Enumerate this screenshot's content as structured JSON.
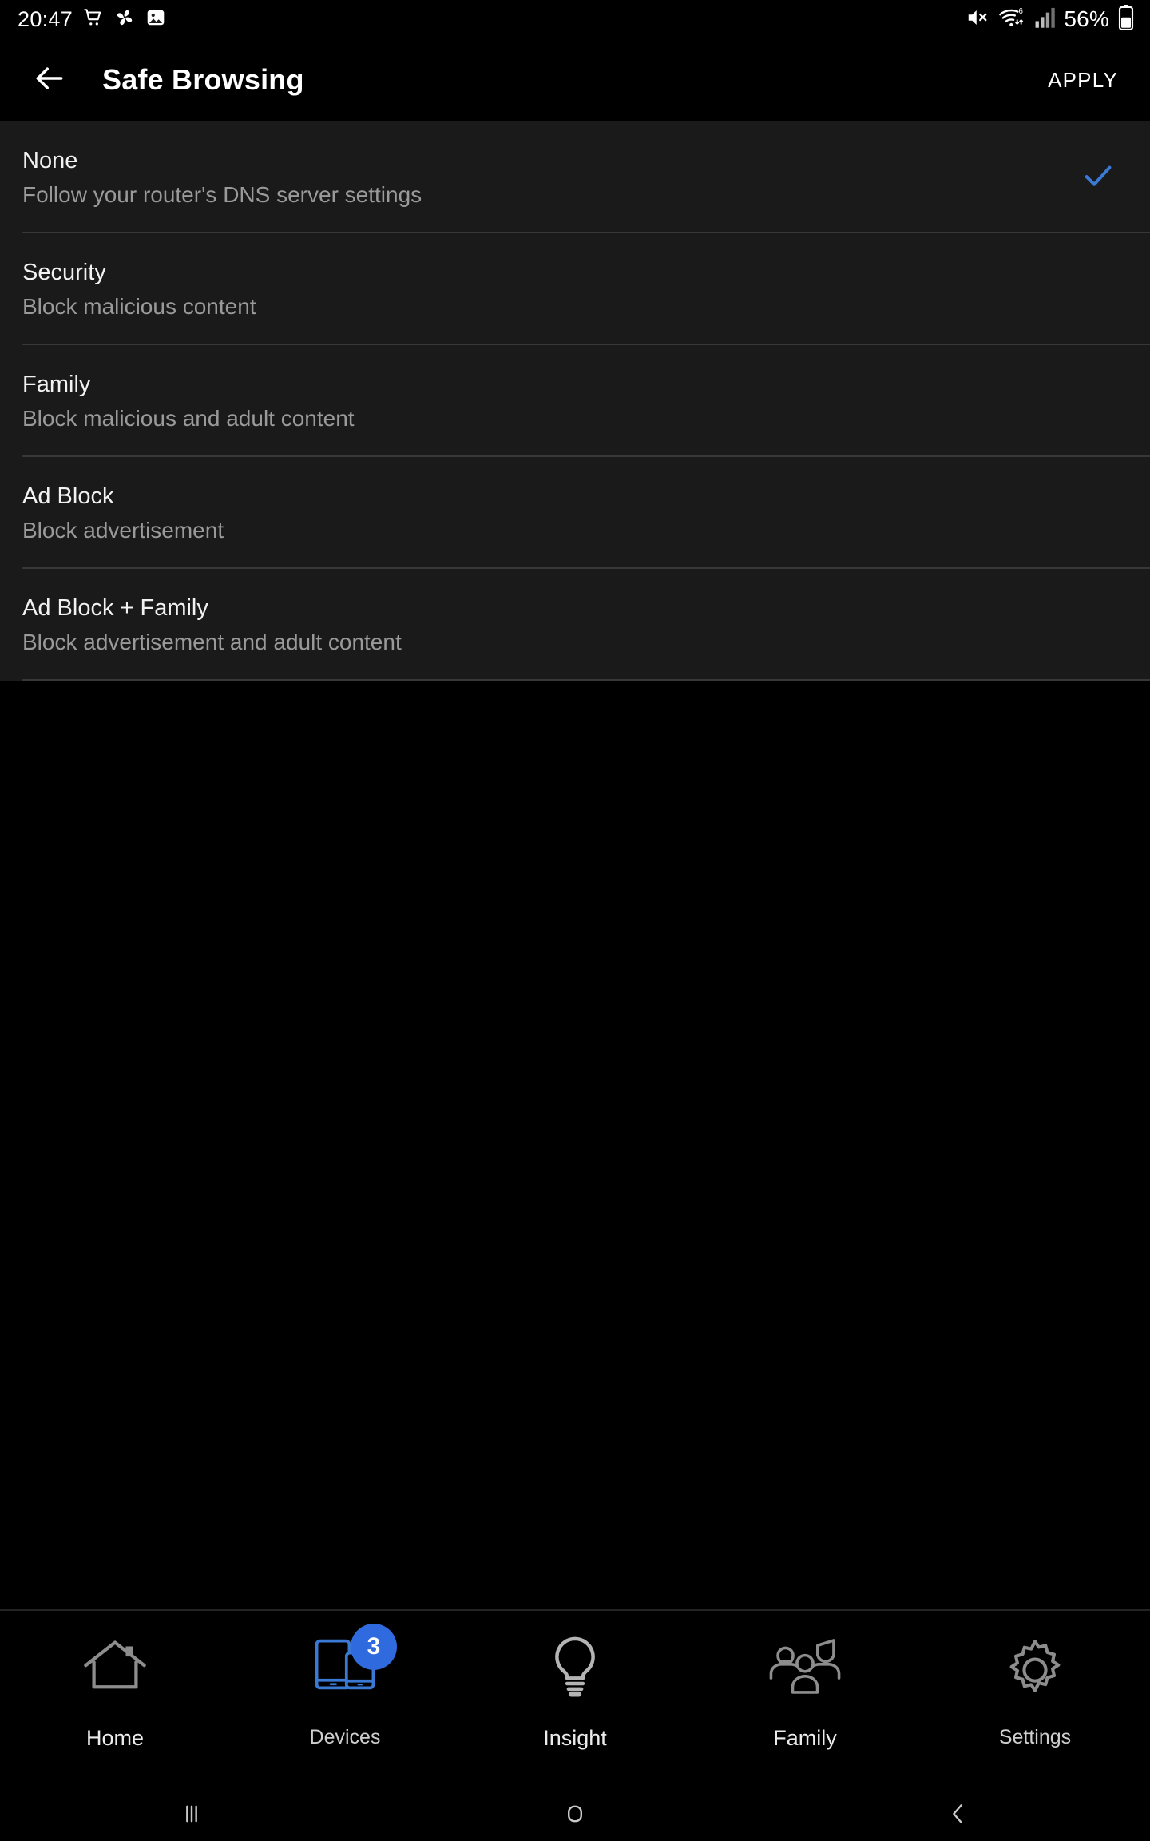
{
  "status_bar": {
    "time": "20:47",
    "battery_percent": "56%",
    "left_icons": [
      "shopping-cart-icon",
      "pinwheel-icon",
      "photo-icon"
    ],
    "right_icons": [
      "mute-icon",
      "wifi6-icon",
      "signal-bars-icon",
      "battery-icon"
    ]
  },
  "header": {
    "back_icon": "back-arrow-icon",
    "title": "Safe Browsing",
    "apply_label": "APPLY"
  },
  "colors": {
    "accent_blue": "#3b7ad4",
    "badge_blue": "#2f6ade",
    "list_background": "#1a1a1a",
    "page_background": "#000000",
    "divider": "#383838",
    "subtitle_grey": "#9a9a9a"
  },
  "options": {
    "selected_index": 0,
    "items": [
      {
        "title": "None",
        "subtitle": "Follow your router's DNS server settings",
        "selected": true
      },
      {
        "title": "Security",
        "subtitle": "Block malicious content",
        "selected": false
      },
      {
        "title": "Family",
        "subtitle": "Block malicious and adult content",
        "selected": false
      },
      {
        "title": "Ad Block",
        "subtitle": "Block advertisement",
        "selected": false
      },
      {
        "title": "Ad Block + Family",
        "subtitle": "Block advertisement and adult content",
        "selected": false
      }
    ]
  },
  "bottom_nav": {
    "items": [
      {
        "label": "Home",
        "icon": "house-icon",
        "badge": ""
      },
      {
        "label": "Devices",
        "icon": "devices-icon",
        "badge": "3"
      },
      {
        "label": "Insight",
        "icon": "lightbulb-icon",
        "badge": ""
      },
      {
        "label": "Family",
        "icon": "people-group-icon",
        "badge": ""
      },
      {
        "label": "Settings",
        "icon": "gear-icon",
        "badge": ""
      }
    ]
  },
  "android_nav": {
    "recents_icon": "recents-icon",
    "home_icon": "home-square-icon",
    "back_icon": "back-chevron-icon"
  }
}
